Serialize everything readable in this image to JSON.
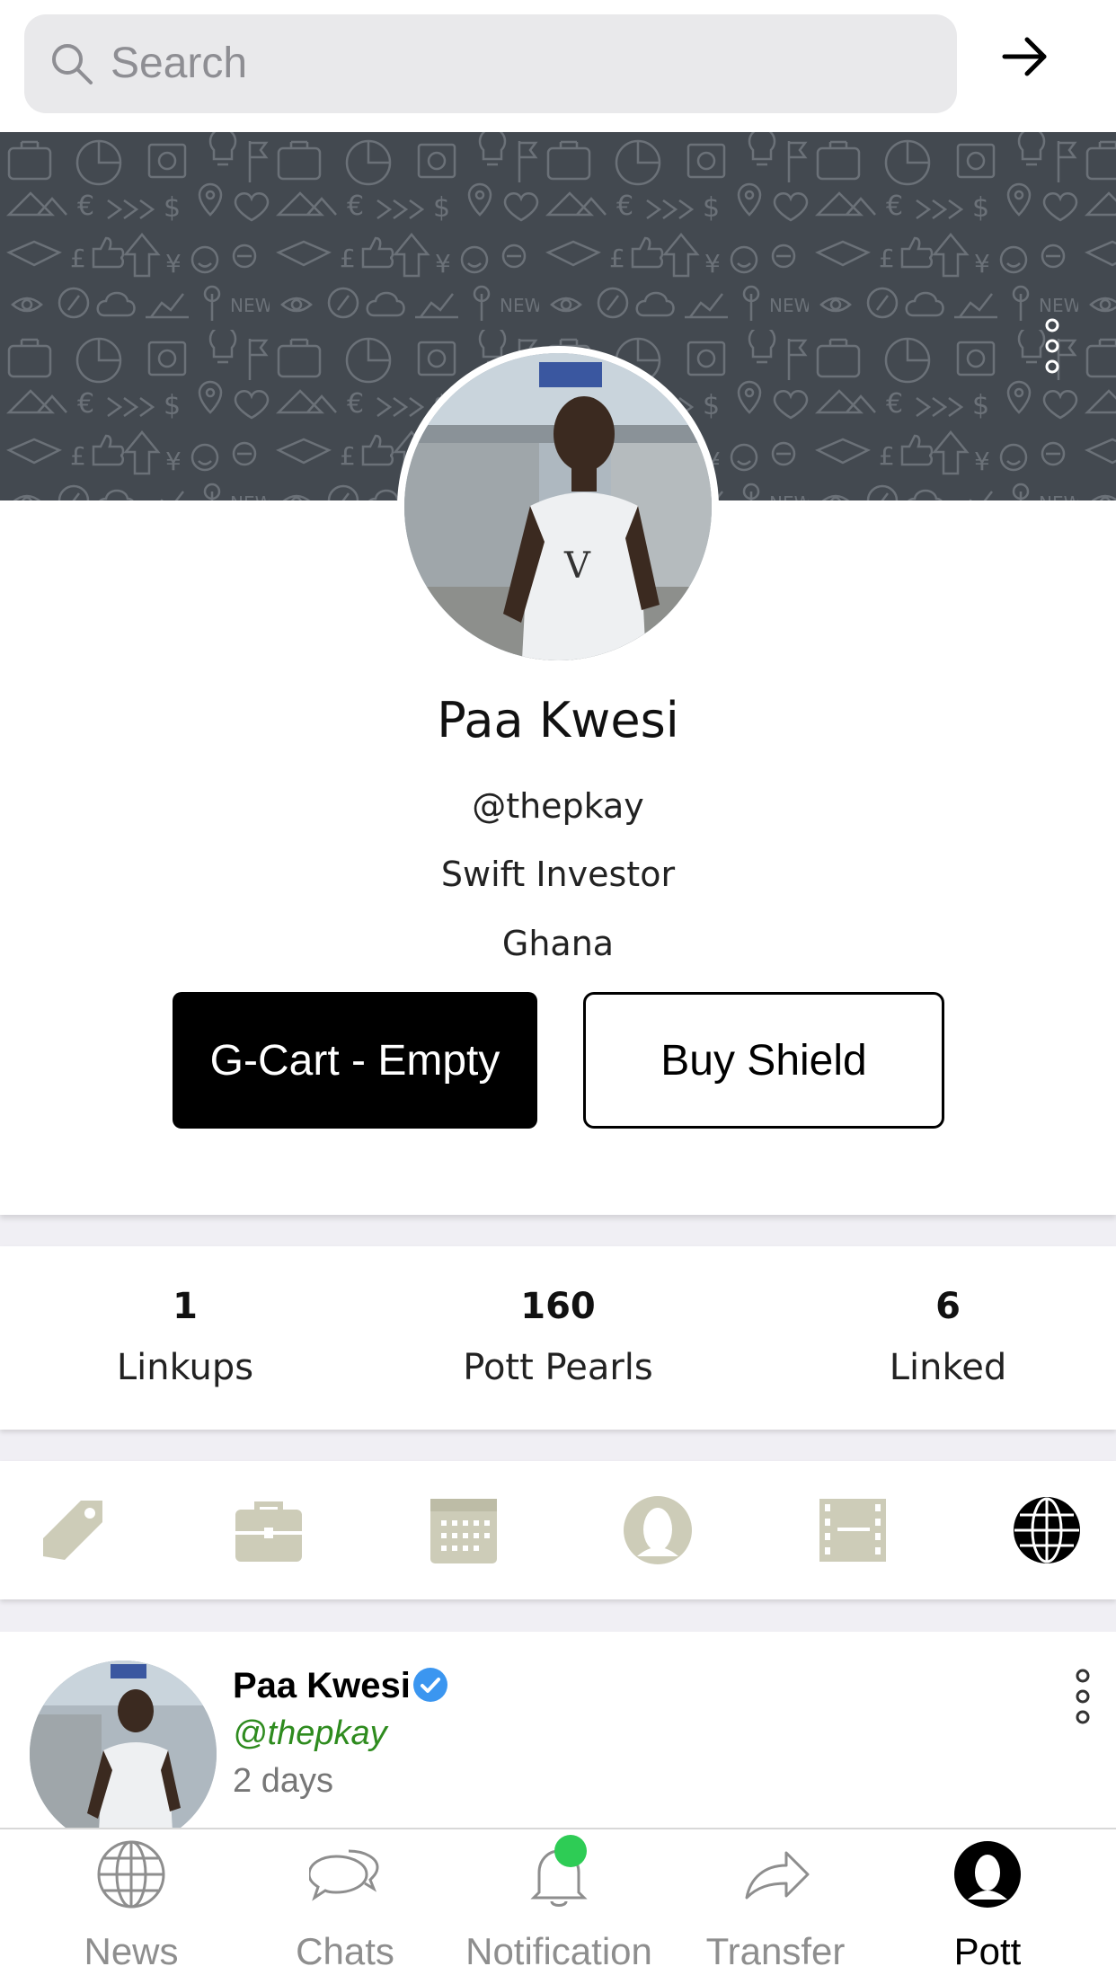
{
  "search": {
    "placeholder": "Search"
  },
  "profile": {
    "name": "Paa Kwesi",
    "handle": "@thepkay",
    "title": "Swift Investor",
    "country": "Ghana",
    "cart_button": "G-Cart - Empty",
    "shield_button": "Buy Shield"
  },
  "stats": [
    {
      "value": "1",
      "label": "Linkups"
    },
    {
      "value": "160",
      "label": "Pott Pearls"
    },
    {
      "value": "6",
      "label": "Linked"
    }
  ],
  "category_icons": [
    "tag-icon",
    "briefcase-icon",
    "calendar-icon",
    "profile-circle-icon",
    "film-icon",
    "globe-icon"
  ],
  "post": {
    "name": "Paa Kwesi",
    "handle": "@thepkay",
    "time": "2 days"
  },
  "nav": {
    "tabs": [
      {
        "label": "News",
        "icon": "globe-icon"
      },
      {
        "label": "Chats",
        "icon": "chat-bubbles-icon"
      },
      {
        "label": "Notification",
        "icon": "bell-icon"
      },
      {
        "label": "Transfer",
        "icon": "share-arrow-icon"
      },
      {
        "label": "Pott",
        "icon": "user-circle-icon",
        "active": true
      }
    ]
  },
  "colors": {
    "icon_tint": "#cdccb8",
    "active": "#000000",
    "handle_green": "#2e8b1e",
    "verified_blue": "#3b96f0",
    "badge_green": "#2ecc55",
    "cover_bg": "#434950"
  }
}
